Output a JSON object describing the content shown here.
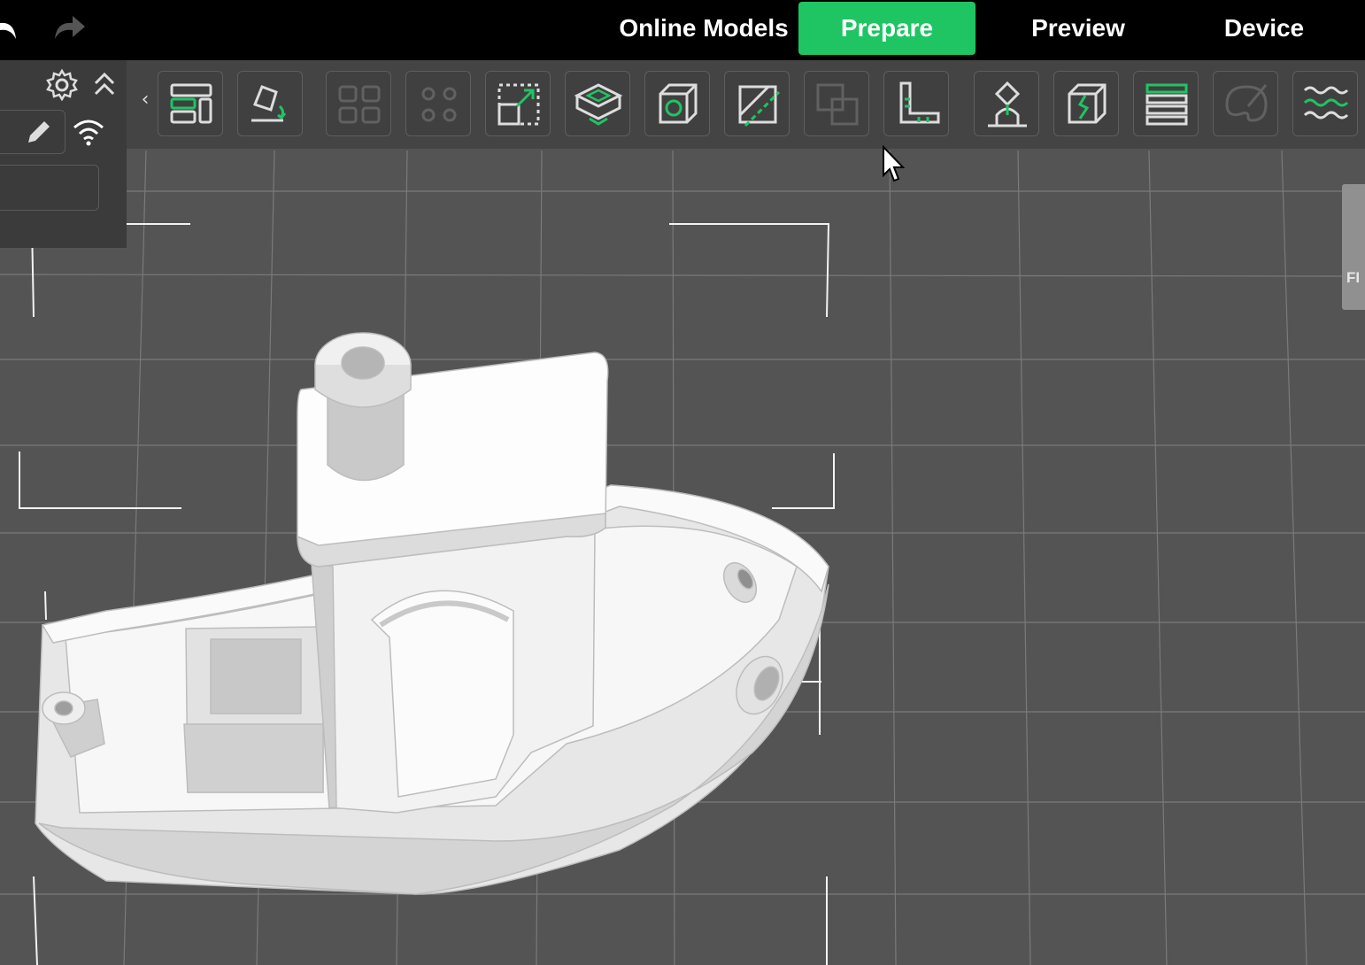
{
  "nav": {
    "tabs": [
      {
        "label": "Online Models",
        "active": false
      },
      {
        "label": "Prepare",
        "active": true
      },
      {
        "label": "Preview",
        "active": false
      },
      {
        "label": "Device",
        "active": false
      }
    ]
  },
  "toolbar": {
    "icons": [
      "arrange-icon",
      "place-on-face-icon",
      "grid-array-icon",
      "auto-orient-icon",
      "scale-icon",
      "plate-icon",
      "object-icon",
      "cut-icon",
      "boolean-icon",
      "measure-icon",
      "support-paint-icon",
      "seam-paint-icon",
      "layers-icon",
      "color-paint-icon",
      "fuzzy-skin-icon"
    ],
    "accent": "#1fc463"
  },
  "right_panel": {
    "label": "FI"
  },
  "colors": {
    "accent": "#1fc463",
    "viewport": "#545454",
    "topbar": "#000000"
  }
}
